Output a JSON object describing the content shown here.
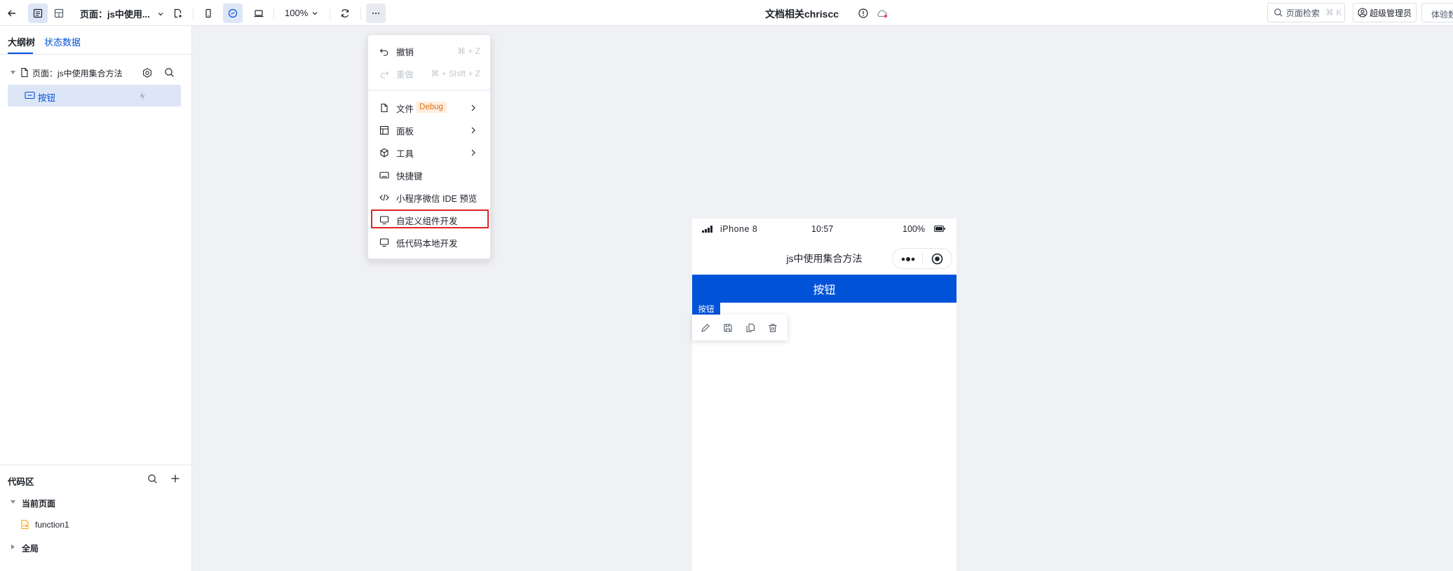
{
  "topbar": {
    "page_selector": "页面：js中使用...",
    "zoom": "100%",
    "doc_title": "文档相关chriscc",
    "search_label": "页面检索",
    "search_shortcut": "⌘ K",
    "user_label": "超级管理员",
    "trial_label": "体验数"
  },
  "sidebar": {
    "tabs": [
      "大纲树",
      "状态数据"
    ],
    "tree": {
      "page_label": "页面：js中使用集合方法",
      "child_label": "按钮"
    },
    "code_area": {
      "title": "代码区",
      "current_page": "当前页面",
      "function_item": "function1",
      "global": "全局"
    }
  },
  "menu": {
    "items": [
      {
        "label": "撤销",
        "shortcut": "⌘ + Z",
        "icon": "undo-icon"
      },
      {
        "label": "重做",
        "shortcut": "⌘ + Shift + Z",
        "icon": "redo-icon"
      },
      {
        "label": "文件",
        "badge": "Debug",
        "icon": "file-icon"
      },
      {
        "label": "面板",
        "icon": "panel-icon"
      },
      {
        "label": "工具",
        "icon": "cube-icon"
      },
      {
        "label": "快捷键",
        "icon": "keyboard-icon"
      },
      {
        "label": "小程序微信 IDE 预览",
        "icon": "code-icon"
      },
      {
        "label": "自定义组件开发",
        "icon": "monitor-icon"
      },
      {
        "label": "低代码本地开发",
        "icon": "monitor-icon"
      }
    ],
    "highlight_color": "#e02424"
  },
  "phone": {
    "carrier": "iPhone 8",
    "time": "10:57",
    "battery": "100%",
    "nav_title": "js中使用集合方法",
    "button_label": "按钮",
    "selected_tag": "按钮"
  },
  "colors": {
    "accent": "#0052d9",
    "selected_row_bg": "#dde6f7",
    "badge_bg": "#fdeee0",
    "badge_text": "#e37318",
    "function_icon": "#f5a623"
  }
}
